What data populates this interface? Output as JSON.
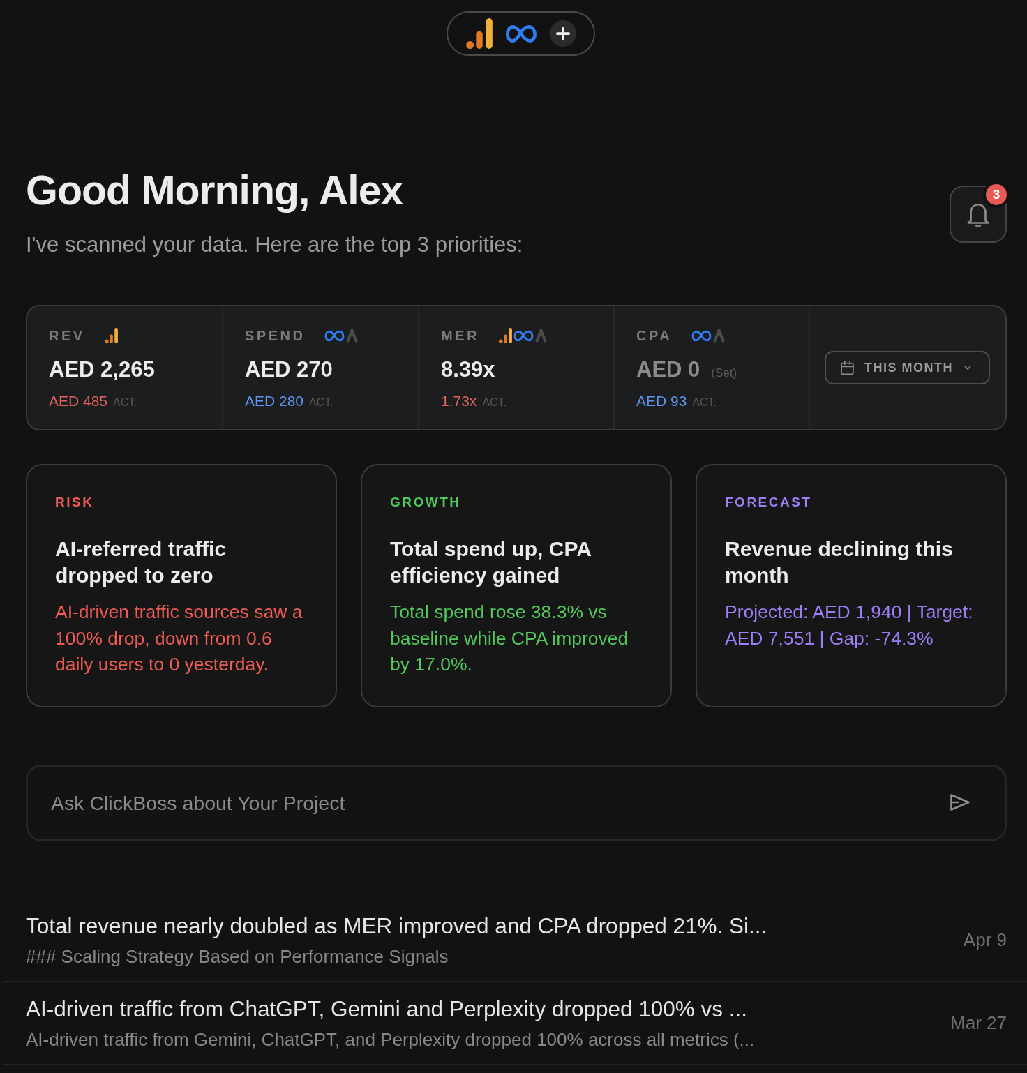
{
  "integrations": {
    "sources": [
      {
        "kind": "bars"
      },
      {
        "kind": "loop"
      }
    ]
  },
  "header": {
    "greeting": "Good Morning, Alex",
    "subtitle": "I've scanned your data. Here are the top 3 priorities:",
    "notifications": {
      "count": "3"
    }
  },
  "metrics": [
    {
      "label": "REV",
      "sources": [
        {
          "kind": "bars"
        }
      ],
      "value": "AED 2,265",
      "dimmed": false,
      "actual": {
        "value": "AED 485",
        "label": "ACT.",
        "color": "#e0625b"
      }
    },
    {
      "label": "SPEND",
      "sources": [
        {
          "kind": "loop"
        },
        {
          "kind": "peak"
        }
      ],
      "value": "AED 270",
      "dimmed": false,
      "actual": {
        "value": "AED 280",
        "label": "ACT.",
        "color": "#5f95ec"
      }
    },
    {
      "label": "MER",
      "sources": [
        {
          "kind": "bars"
        },
        {
          "kind": "loop"
        },
        {
          "kind": "peak"
        }
      ],
      "value": "8.39x",
      "dimmed": false,
      "actual": {
        "value": "1.73x",
        "label": "ACT.",
        "color": "#e0625b"
      }
    },
    {
      "label": "CPA",
      "sources": [
        {
          "kind": "loop"
        },
        {
          "kind": "peak"
        }
      ],
      "value": "AED 0",
      "note": "(Set)",
      "dimmed": true,
      "actual": {
        "value": "AED 93",
        "label": "ACT.",
        "color": "#5f95ec"
      }
    }
  ],
  "period": {
    "label": "THIS MONTH"
  },
  "insights": [
    {
      "label": "RISK",
      "color": "#ee5b55",
      "title": "AI-referred traffic dropped to zero",
      "body": "AI-driven traffic sources saw a 100% drop, down from 0.6 daily users to 0 yesterday."
    },
    {
      "label": "GROWTH",
      "color": "#50c85a",
      "title": "Total spend up, CPA efficiency gained",
      "body": "Total spend rose 38.3% vs baseline while CPA improved by 17.0%."
    },
    {
      "label": "FORECAST",
      "color": "#9d7ef5",
      "title": "Revenue declining this month",
      "body": "Projected: AED 1,940 | Target: AED 7,551 | Gap: -74.3%"
    }
  ],
  "chat": {
    "placeholder": "Ask ClickBoss about Your Project"
  },
  "conversations": [
    {
      "title": "Total revenue nearly doubled as MER improved and CPA dropped 21%. Si...",
      "summary": "### Scaling Strategy Based on Performance Signals",
      "date": "Apr 9"
    },
    {
      "title": "AI-driven traffic from ChatGPT, Gemini and Perplexity dropped 100% vs ...",
      "summary": "AI-driven traffic from Gemini, ChatGPT, and Perplexity dropped 100% across all metrics (...",
      "date": "Mar 27"
    }
  ]
}
